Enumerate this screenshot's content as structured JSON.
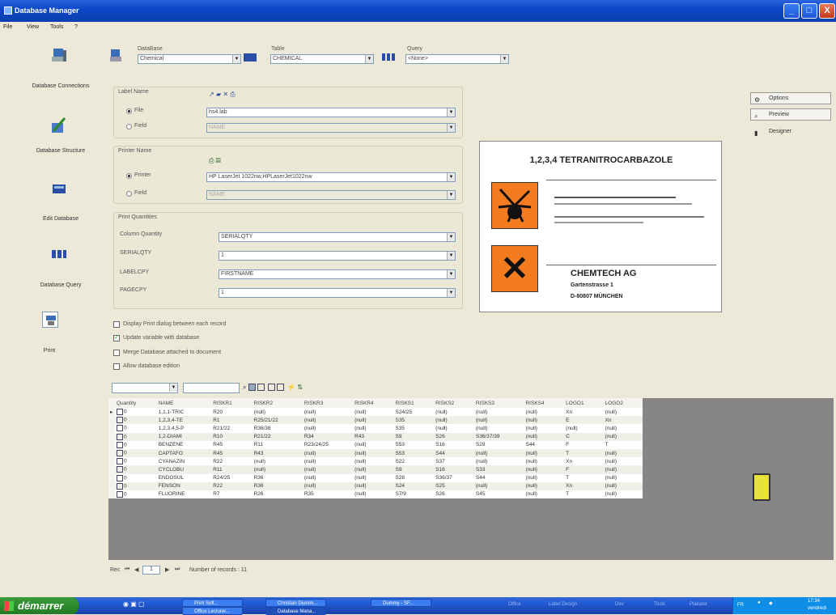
{
  "window": {
    "title": "Database Manager",
    "min": "_",
    "max": "□",
    "close": "X"
  },
  "menu": [
    "File",
    "View",
    "Tools",
    "?"
  ],
  "nav": [
    {
      "label": "Database Connections",
      "icon": "database-connections-icon"
    },
    {
      "label": "Database Structure",
      "icon": "database-structure-icon"
    },
    {
      "label": "Edit Database",
      "icon": "edit-database-icon"
    },
    {
      "label": "Database Query",
      "icon": "database-query-icon"
    },
    {
      "label": "Print",
      "icon": "print-icon"
    }
  ],
  "selectors": {
    "database_label": "DataBase",
    "database_value": "Chemical",
    "table_label": "Table",
    "table_value": "CHEMICAL",
    "query_label": "Query",
    "query_value": "<None>"
  },
  "label_name": {
    "title": "Label Name",
    "file_option": "File",
    "file_value": "hs4.lab",
    "field_option": "Field",
    "field_value": "NAME"
  },
  "printer_name": {
    "title": "Printer Name",
    "printer_option": "Printer",
    "printer_value": "HP LaserJet 1022nw,HPLaserJet1022nw",
    "field_option": "Field",
    "field_value": "NAME"
  },
  "print_quantities": {
    "title": "Print Quantities",
    "rows": [
      {
        "label": "Column Quantity",
        "value": "SERIALQTY"
      },
      {
        "label": "SERIALQTY",
        "value": "1"
      },
      {
        "label": "LABELCPY",
        "value": "FIRSTNAME"
      },
      {
        "label": "PAGECPY",
        "value": "1"
      }
    ]
  },
  "options": [
    {
      "label": "Display Print dialog between each record",
      "checked": false
    },
    {
      "label": "Update variable with database",
      "checked": true
    },
    {
      "label": "Merge Database attached to document",
      "checked": false
    },
    {
      "label": "Allow database edition",
      "checked": false
    }
  ],
  "side_buttons": [
    "Options",
    "Preview",
    "Designer"
  ],
  "preview": {
    "title": "1,2,3,4 TETRANITROCARBAZOLE",
    "company": "CHEMTECH AG",
    "street": "Gartenstrasse 1",
    "city": "D-80807 MÜNCHEN"
  },
  "grid": {
    "columns": [
      "Quantity",
      "NAME",
      "RISKR1",
      "RISKR2",
      "RISKR3",
      "RISKR4",
      "RISKS1",
      "RISKS2",
      "RISKS3",
      "RISKS4",
      "LOGO1",
      "LOGO2"
    ],
    "rows": [
      [
        "0",
        "1,1,1-TRIC",
        "R20",
        "(null)",
        "(null)",
        "(null)",
        "S24/25",
        "(null)",
        "(null)",
        "(null)",
        "Xn",
        "(null)"
      ],
      [
        "0",
        "1,2,3,4-TE",
        "R1",
        "R25/21/22",
        "(null)",
        "(null)",
        "S35",
        "(null)",
        "(null)",
        "(null)",
        "E",
        "Xn"
      ],
      [
        "0",
        "1,2,3,4,5-P",
        "R21/22",
        "R36/38",
        "(null)",
        "(null)",
        "S35",
        "(null)",
        "(null)",
        "(null)",
        "(null)",
        "(null)"
      ],
      [
        "0",
        "1,2-DIAMI",
        "R10",
        "R21/22",
        "R34",
        "R43",
        "S9",
        "S26",
        "S36/37/39",
        "(null)",
        "C",
        "(null)"
      ],
      [
        "0",
        "BENZENE",
        "R45",
        "R11",
        "R23/24/25",
        "(null)",
        "S53",
        "S16",
        "S29",
        "S44",
        "F",
        "T"
      ],
      [
        "0",
        "CAPTAFO",
        "R45",
        "R43",
        "(null)",
        "(null)",
        "S53",
        "S44",
        "(null)",
        "(null)",
        "T",
        "(null)"
      ],
      [
        "0",
        "CYANAZIN",
        "R22",
        "(null)",
        "(null)",
        "(null)",
        "S22",
        "S37",
        "(null)",
        "(null)",
        "Xn",
        "(null)"
      ],
      [
        "0",
        "CYCLOBU",
        "R11",
        "(null)",
        "(null)",
        "(null)",
        "S9",
        "S16",
        "S33",
        "(null)",
        "F",
        "(null)"
      ],
      [
        "0",
        "ENDOSUL",
        "R24/25",
        "R36",
        "(null)",
        "(null)",
        "S28",
        "S36/37",
        "S44",
        "(null)",
        "T",
        "(null)"
      ],
      [
        "0",
        "FENSON",
        "R22",
        "R36",
        "(null)",
        "(null)",
        "S24",
        "S25",
        "(null)",
        "(null)",
        "Xn",
        "(null)"
      ],
      [
        "0",
        "FLUORINE",
        "R7",
        "R26",
        "R35",
        "(null)",
        "S7/9",
        "S26",
        "S45",
        "(null)",
        "T",
        "(null)"
      ]
    ]
  },
  "status": {
    "rec_label": "Rec",
    "rec_value": "1",
    "count_text": "Number of records : 11"
  },
  "taskbar": {
    "start": "démarrer",
    "tasks": [
      "Print Soft...",
      "Christian Diumm...",
      "Dummy - SF...",
      "Office Lecturer...",
      "Database Mana..."
    ],
    "faded": [
      "Office",
      "Label Design",
      "Dev",
      "Tools",
      "Plakater"
    ],
    "lang": "FR",
    "time": "17:34",
    "day": "vendredi"
  },
  "colors": {
    "accent": "#0a48c8",
    "start_green": "#2e8b2e",
    "orange": "#f47b20"
  }
}
